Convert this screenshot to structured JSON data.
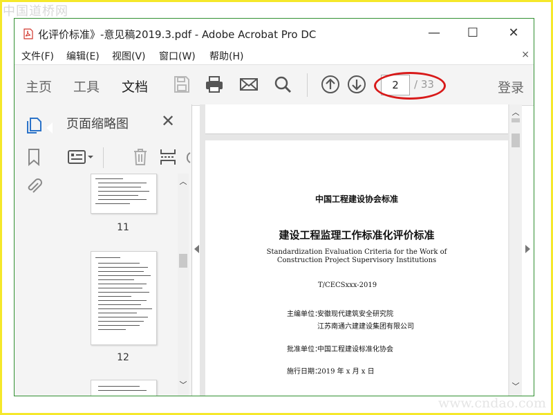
{
  "watermark": {
    "top": "中国道桥网",
    "bottom": "www.cndao.com"
  },
  "window": {
    "title": "化评价标准》-意见稿2019.3.pdf - Adobe Acrobat Pro DC",
    "minimize": "—",
    "maximize": "☐",
    "close": "✕"
  },
  "menu": {
    "items": [
      "文件(F)",
      "编辑(E)",
      "视图(V)",
      "窗口(W)",
      "帮助(H)"
    ],
    "close": "×"
  },
  "toolbar": {
    "tabs": [
      "主页",
      "工具",
      "文档"
    ],
    "active_tab": "文档",
    "current_page": "2",
    "total_pages": "/ 33",
    "login": "登录",
    "icons": [
      "save-icon",
      "print-icon",
      "mail-icon",
      "search-icon",
      "page-up-icon",
      "page-down-icon"
    ]
  },
  "leftrail": {
    "icons": [
      "page-thumbnails-icon",
      "bookmark-icon",
      "attachment-icon"
    ]
  },
  "thumbnails_panel": {
    "title": "页面缩略图",
    "close": "✕",
    "tools": [
      "options-menu-icon",
      "delete-icon",
      "insert-page-icon",
      "rotate-icon"
    ],
    "pages": [
      {
        "number": "11",
        "current": false
      },
      {
        "number": "12",
        "current": false
      },
      {
        "number": "",
        "current": false
      }
    ]
  },
  "document": {
    "org_standard": "中国工程建设协会标准",
    "title_cn": "建设工程监理工作标准化评价标准",
    "title_en_1": "Standardization Evaluation Criteria for the Work of",
    "title_en_2": "Construction Project Supervisory Institutions",
    "code": "T/CECSxxx-2019",
    "chief_label": "主编单位：",
    "chief_unit_1": "安徽现代建筑安全研究院",
    "chief_unit_2": "江苏南通六建建设集团有限公司",
    "approve_label": "批准单位：",
    "approve_unit": "中国工程建设标准化协会",
    "date_label": "施行日期：",
    "date_value": "2019 年 x 月 x 日"
  },
  "colors": {
    "highlight_ellipse": "#d81a1a",
    "frame": "#f5e82a",
    "active_rail_icon": "#2a72c8",
    "pdf_icon": "#d0352b"
  }
}
